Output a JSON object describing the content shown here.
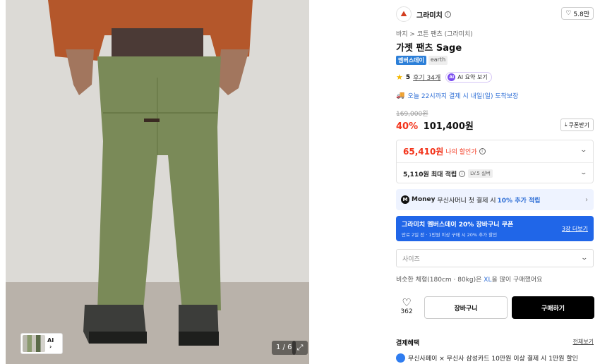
{
  "gallery": {
    "counter": "1 / 6",
    "thumb_ai_label": "AI",
    "thumb_ai_arrow": "›",
    "expand_icon": "⤢"
  },
  "brand": {
    "name": "그라미치",
    "logo_glyph": "⛰",
    "likes": "5.8만"
  },
  "product": {
    "breadcrumb": "바지 > 코튼 팬츠 (그라미치)",
    "title": "가젯 팬츠 Sage",
    "badges": [
      "멤버스데이",
      "earth"
    ]
  },
  "rating": {
    "score": "5",
    "reviews": "후기 34개",
    "ai_badge": "AI",
    "ai_summary": "AI 요약 보기"
  },
  "delivery": {
    "text": "오늘 22시까지 결제 시 내일(일) 도착보장"
  },
  "price": {
    "original": "169,000원",
    "discount": "40%",
    "sale": "101,400원",
    "coupon_button": "쿠폰받기",
    "my_price": "65,410원",
    "my_price_label": "나의 할인가",
    "points": "5,110원 최대 적립",
    "level": "LV.5 실버"
  },
  "money": {
    "logo": "M",
    "brand": "Money",
    "text_before": "무신사머니 첫 결제 시",
    "accent": "10% 추가 적립"
  },
  "coupon_banner": {
    "title": "그라미치 멤버스데이 20% 장바구니 쿠폰",
    "sub": "만료 2일 전 · 1만원 이상 구매 시 20% 추가 할인",
    "more": "3장 더보기"
  },
  "size": {
    "placeholder": "사이즈"
  },
  "similar": {
    "before": "비슷한 체형(180cm · 80kg)은",
    "accent": "XL",
    "after": "을 많이 구매했어요"
  },
  "actions": {
    "like_count": "362",
    "cart": "장바구니",
    "buy": "구매하기"
  },
  "benefits": {
    "title": "결제혜택",
    "all": "전체보기",
    "row": "무신사페이 × 무신사 삼성카드 10만원 이상 결제 시 1만원 할인"
  },
  "colors": {
    "accent_red": "#f3341b",
    "accent_blue": "#2f6fd6",
    "banner_blue": "#2066e8",
    "buy_black": "#000000"
  }
}
